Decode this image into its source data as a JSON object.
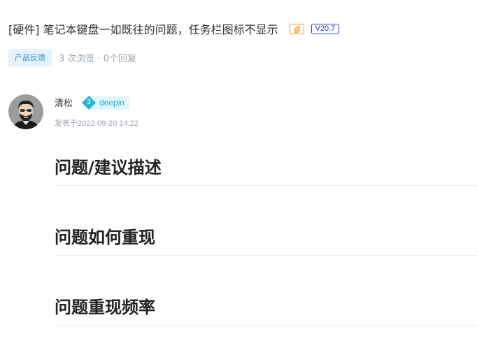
{
  "post": {
    "title": "[硬件] 笔记本键盘一如既往的问题，任务栏图标不显示",
    "attachment_icon": "paperclip-icon",
    "version": "V20.7",
    "category": "产品反馈",
    "stats": "3 次浏览 · 0个回复"
  },
  "author": {
    "name": "清松",
    "level": "3",
    "level_name": "deepin",
    "posted_at": "发表于2022-09-20 14:22"
  },
  "sections": [
    {
      "heading": "问题/建议描述"
    },
    {
      "heading": "问题如何重现"
    },
    {
      "heading": "问题重现频率"
    }
  ],
  "colors": {
    "tag_bg": "#e6f3fd",
    "tag_text": "#2f8fe6",
    "version_border": "#3344cc",
    "attachment_border": "#f0a020",
    "level_accent": "#22a8cc"
  }
}
